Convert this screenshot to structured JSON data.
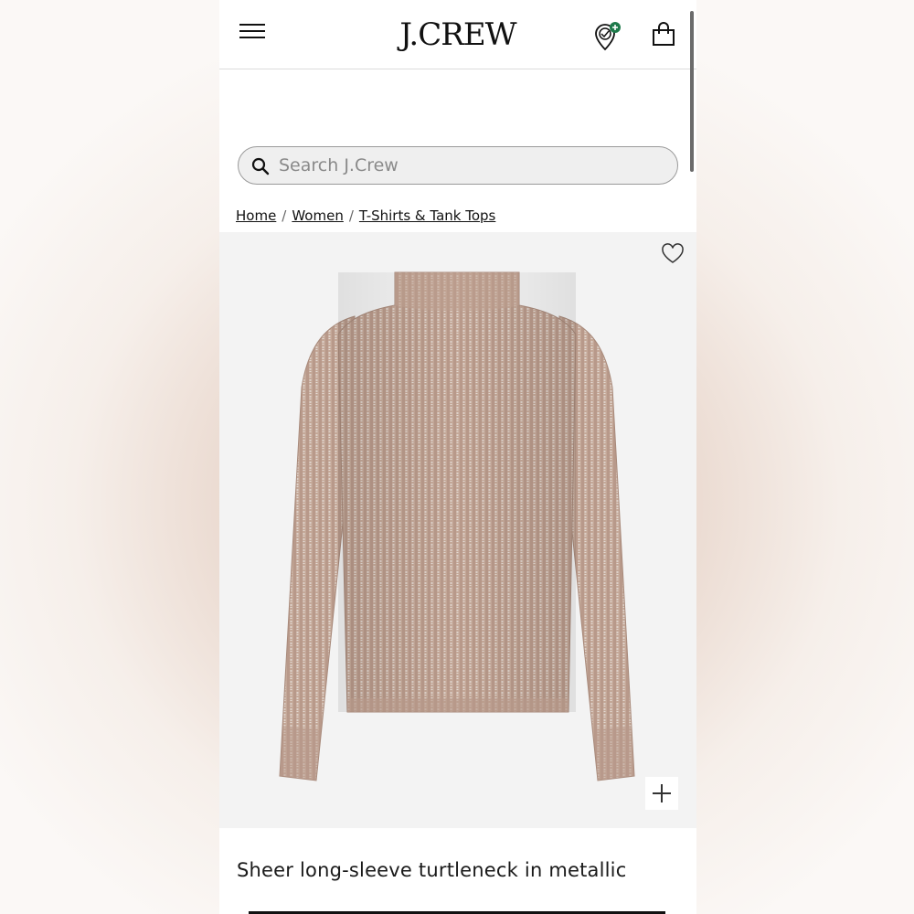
{
  "header": {
    "logo": "J.CREW",
    "icons": [
      "menu-icon",
      "rewards-icon",
      "shopping-bag-icon"
    ]
  },
  "search": {
    "placeholder": "Search J.Crew",
    "value": ""
  },
  "breadcrumb": {
    "items": [
      "Home",
      "Women",
      "T-Shirts & Tank Tops"
    ],
    "separator": "/"
  },
  "product": {
    "title": "Sheer long-sleeve turtleneck in metallic",
    "image_alt": "Sheer long-sleeve turtleneck in metallic",
    "icons": [
      "heart-icon",
      "zoom-plus-icon"
    ]
  },
  "colors": {
    "accent_badge": "#1d7a4a",
    "text": "#111111",
    "garment": "#c7ab9b"
  }
}
